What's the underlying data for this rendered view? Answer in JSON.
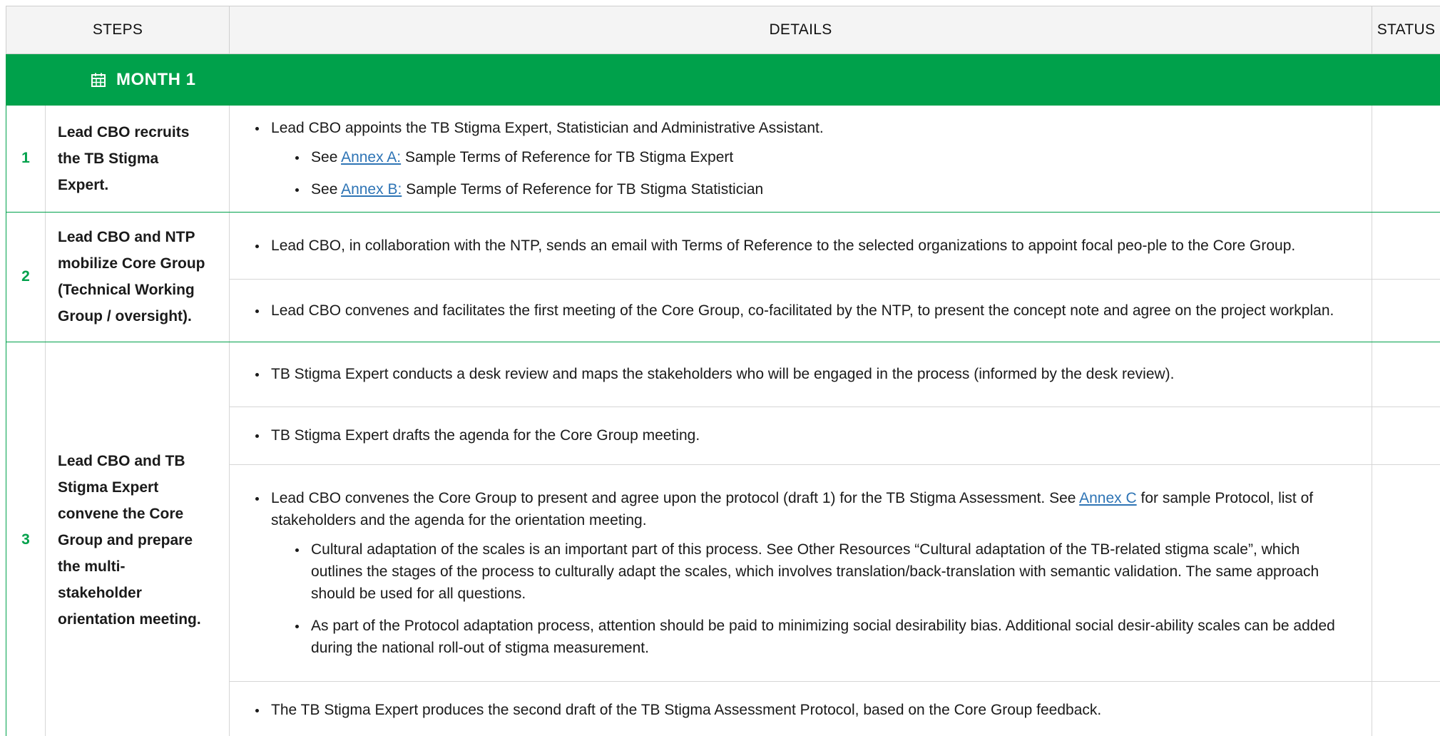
{
  "header": {
    "steps": "STEPS",
    "details": "DETAILS",
    "status": "STATUS"
  },
  "month": {
    "icon": "calendar-icon",
    "label": "MONTH 1"
  },
  "colors": {
    "green": "#00a14b",
    "link": "#2e74b5",
    "header_bg": "#f4f4f4"
  },
  "rows": [
    {
      "num": "1",
      "step": "Lead CBO recruits the TB Stigma Expert.",
      "details": [
        {
          "text": "Lead CBO appoints the TB Stigma Expert, Statistician and Administrative Assistant.",
          "sub": [
            {
              "pre": "See ",
              "link": "Annex A:",
              "post": " Sample Terms of Reference for TB Stigma Expert"
            },
            {
              "pre": "See ",
              "link": "Annex B:",
              "post": " Sample Terms of Reference for TB Stigma Statistician"
            }
          ]
        }
      ]
    },
    {
      "num": "2",
      "step": "Lead CBO and NTP mobilize Core Group (Technical Working Group / oversight).",
      "details": [
        {
          "text": "Lead CBO, in collaboration with the NTP, sends an email with Terms of Reference to the selected organizations to appoint focal peo-ple to the Core Group."
        },
        {
          "text": "Lead CBO convenes and facilitates the first meeting of the Core Group, co-facilitated by the NTP, to present the concept note and agree on the project workplan."
        }
      ]
    },
    {
      "num": "3",
      "step": "Lead CBO and TB Stigma Expert convene the Core Group and prepare the multi-stakeholder orientation meeting.",
      "details": [
        {
          "text": "TB Stigma Expert conducts a desk review and maps the stakeholders who will be engaged in the process (informed by the desk review)."
        },
        {
          "text": "TB Stigma Expert drafts the agenda for the Core Group meeting."
        },
        {
          "pre": "Lead CBO convenes the Core Group to present and agree upon the protocol (draft 1) for the TB Stigma Assessment. See ",
          "link": "Annex C",
          "post": " for sample Protocol, list of stakeholders and the agenda for the orientation meeting.",
          "sub": [
            "Cultural adaptation of the scales is an important part of this process. See Other Resources “Cultural adaptation of the TB-related stigma scale”, which outlines the stages of the process to culturally adapt the scales, which involves translation/back-translation with semantic validation. The same approach should be used for all questions.",
            "As part of the Protocol adaptation process, attention should be paid to minimizing social desirability bias. Additional social desir-ability scales can be added during the national roll-out of stigma measurement."
          ]
        },
        {
          "text": "The TB Stigma Expert produces the second draft of the TB Stigma Assessment Protocol, based on the Core Group feedback."
        }
      ]
    }
  ]
}
